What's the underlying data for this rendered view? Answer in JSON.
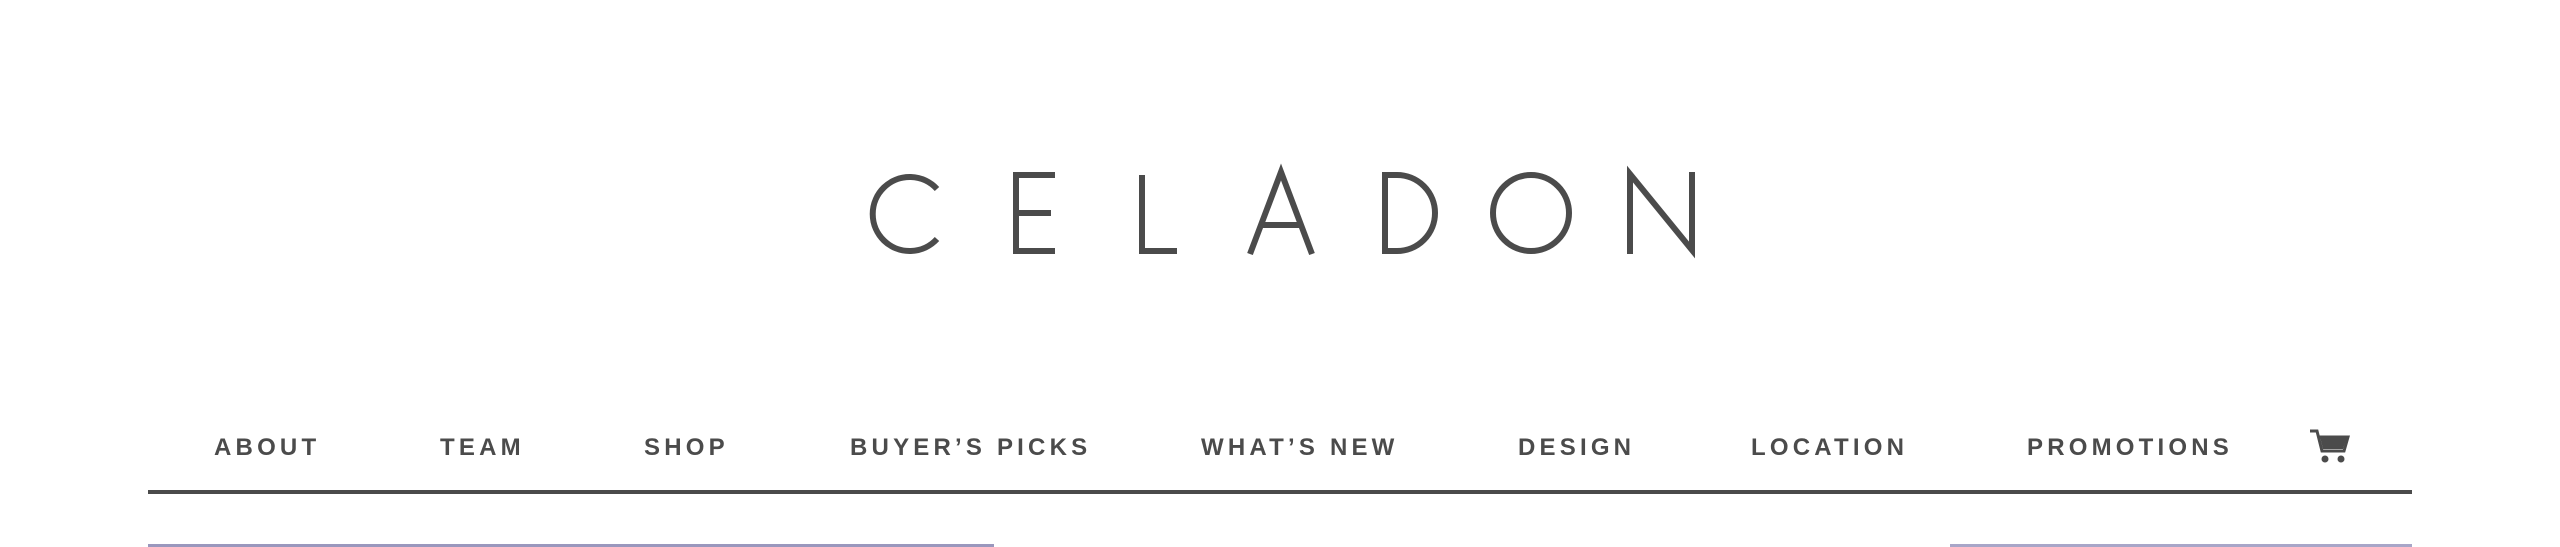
{
  "brand": {
    "name": "CELADON",
    "color": "#4b4b4b"
  },
  "nav": {
    "items": [
      {
        "label": "ABOUT"
      },
      {
        "label": "TEAM"
      },
      {
        "label": "SHOP"
      },
      {
        "label": "BUYER’S PICKS"
      },
      {
        "label": "WHAT’S NEW"
      },
      {
        "label": "DESIGN"
      },
      {
        "label": "LOCATION"
      },
      {
        "label": "PROMOTIONS"
      }
    ],
    "cart_icon": "shopping-cart-icon"
  },
  "colors": {
    "text": "#4b4b4b",
    "rule": "#4b4b4b",
    "banner_edge": "#9a97bd"
  }
}
